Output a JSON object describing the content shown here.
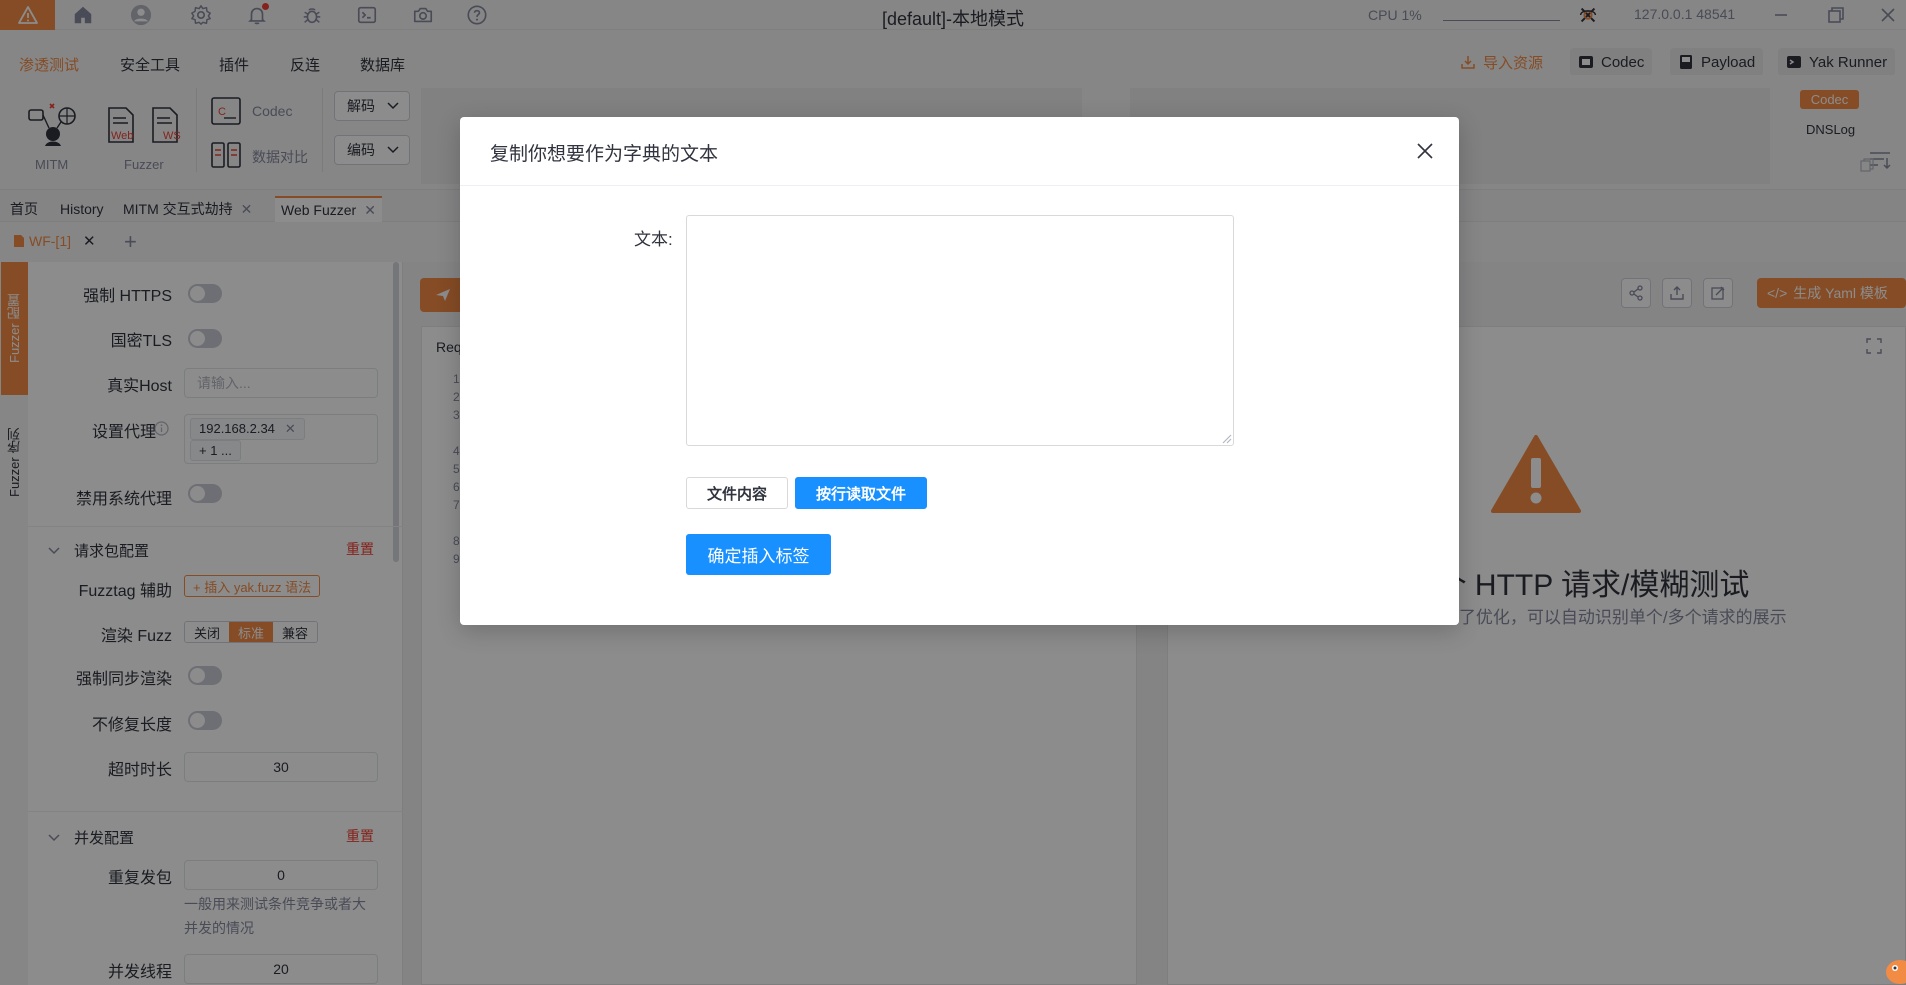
{
  "titlebar": {
    "window_title": "[default]-本地模式",
    "cpu_label": "CPU 1%",
    "address": "127.0.0.1 48541",
    "icons": [
      "warning-icon",
      "home-icon",
      "user-avatar-icon",
      "settings-icon",
      "bell-icon",
      "bug-icon",
      "terminal-icon",
      "camera-icon",
      "help-icon",
      "network-icon"
    ]
  },
  "menu": {
    "items": [
      "渗透测试",
      "安全工具",
      "插件",
      "反连",
      "数据库"
    ],
    "active": "渗透测试",
    "right": {
      "import": "导入资源",
      "codec": "Codec",
      "payload": "Payload",
      "yak_runner": "Yak Runner"
    }
  },
  "ribbon": {
    "mitm": "MITM",
    "fuzzer": "Fuzzer",
    "web": "Web",
    "ws": "WS",
    "codec": "Codec",
    "compare": "数据对比",
    "decode": "解码",
    "encode": "编码",
    "side_tags": [
      "Codec",
      "DNSLog"
    ]
  },
  "tabs": {
    "items": [
      {
        "label": "首页",
        "closable": false
      },
      {
        "label": "History",
        "closable": false
      },
      {
        "label": "MITM 交互式劫持",
        "closable": true
      },
      {
        "label": "Web Fuzzer",
        "closable": true
      }
    ],
    "active": "Web Fuzzer",
    "subtab": "WF-[1]",
    "add": "+"
  },
  "vstrip": {
    "config": "Fuzzer 配置",
    "sequence": "Fuzzer 序列"
  },
  "config": {
    "force_https": "强制 HTTPS",
    "gm_tls": "国密TLS",
    "real_host": "真实Host",
    "real_host_placeholder": "请输入...",
    "proxy": "设置代理",
    "proxy_value": "192.168.2.34",
    "proxy_more": "+ 1 ...",
    "disable_system_proxy": "禁用系统代理",
    "request_section": "请求包配置",
    "reset": "重置",
    "fuzztag_helper": "Fuzztag 辅助",
    "insert_fuzz": "+ 插入 yak.fuzz 语法",
    "render_fuzz": "渲染 Fuzz",
    "render_options": [
      "关闭",
      "标准",
      "兼容"
    ],
    "render_selected": "标准",
    "force_sync_render": "强制同步渲染",
    "no_fix_length": "不修复长度",
    "timeout": "超时时长",
    "timeout_value": "30",
    "concurrency_section": "并发配置",
    "repeat_send": "重复发包",
    "repeat_value": "0",
    "repeat_help": "一般用来测试条件竞争或者大并发的情况",
    "threads": "并发线程",
    "threads_value": "20"
  },
  "main": {
    "request_title": "Req",
    "line_numbers": [
      "1",
      "2",
      "3",
      "",
      "4",
      "5",
      "6",
      "7",
      "",
      "8",
      "9"
    ],
    "yaml_button": "生成 Yaml 模板",
    "empty_title": "发送一个 HTTP 请求/模糊测试",
    "empty_desc": "TTP 请求结果展示做了优化，可以自动识别单个/多个请求的展示"
  },
  "modal": {
    "title": "复制你想要作为字典的文本",
    "text_label": "文本:",
    "textarea_value": "",
    "options": [
      "文件内容",
      "按行读取文件"
    ],
    "selected_option": "按行读取文件",
    "confirm": "确定插入标签"
  },
  "colors": {
    "accent": "#f28b44",
    "primary": "#1890ff",
    "danger": "#f04134"
  }
}
